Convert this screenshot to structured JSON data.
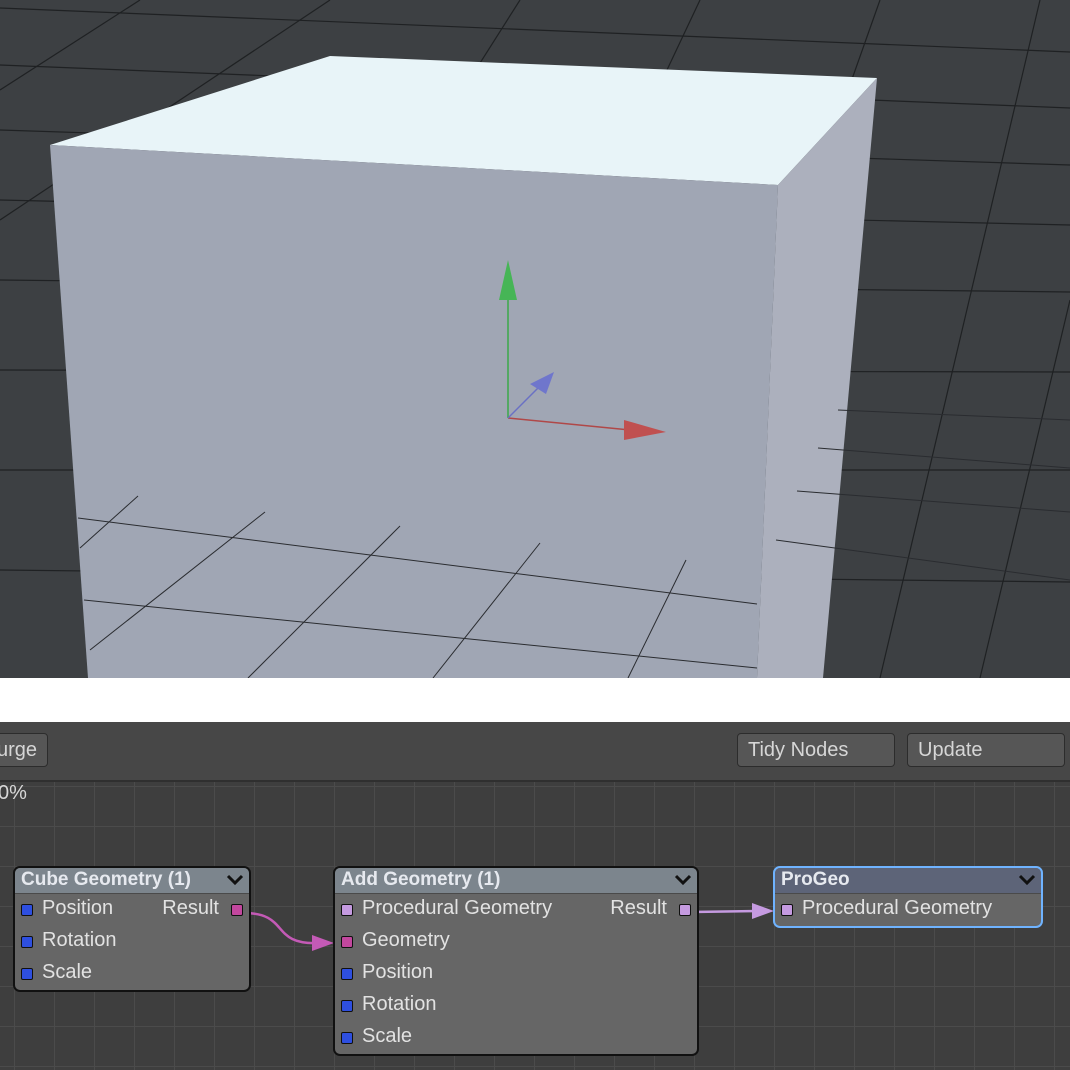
{
  "viewport": {
    "colors": {
      "background": "#3d4043",
      "cube_front": "#9fa5b3",
      "cube_top": "#e6f2f8",
      "cube_side": "#b0b4c1",
      "axis_x": "#b84a4a",
      "axis_y": "#3fb34f",
      "axis_z": "#6c73c9"
    }
  },
  "toolbar": {
    "purge_label": "urge",
    "tidy_label": "Tidy Nodes",
    "update_label": "Update"
  },
  "editor": {
    "zoom_label": "0%"
  },
  "nodes": {
    "cube": {
      "title": "Cube Geometry (1)",
      "inputs": [
        "Position",
        "Rotation",
        "Scale"
      ],
      "output": "Result"
    },
    "add": {
      "title": "Add Geometry (1)",
      "inputs": [
        "Procedural Geometry",
        "Geometry",
        "Position",
        "Rotation",
        "Scale"
      ],
      "output": "Result"
    },
    "progeo": {
      "title": "ProGeo",
      "inputs": [
        "Procedural Geometry"
      ]
    }
  },
  "port_colors": {
    "vector": "#2e4fe0",
    "geometry": "#c2479e",
    "procedural": "#c59ae0"
  }
}
